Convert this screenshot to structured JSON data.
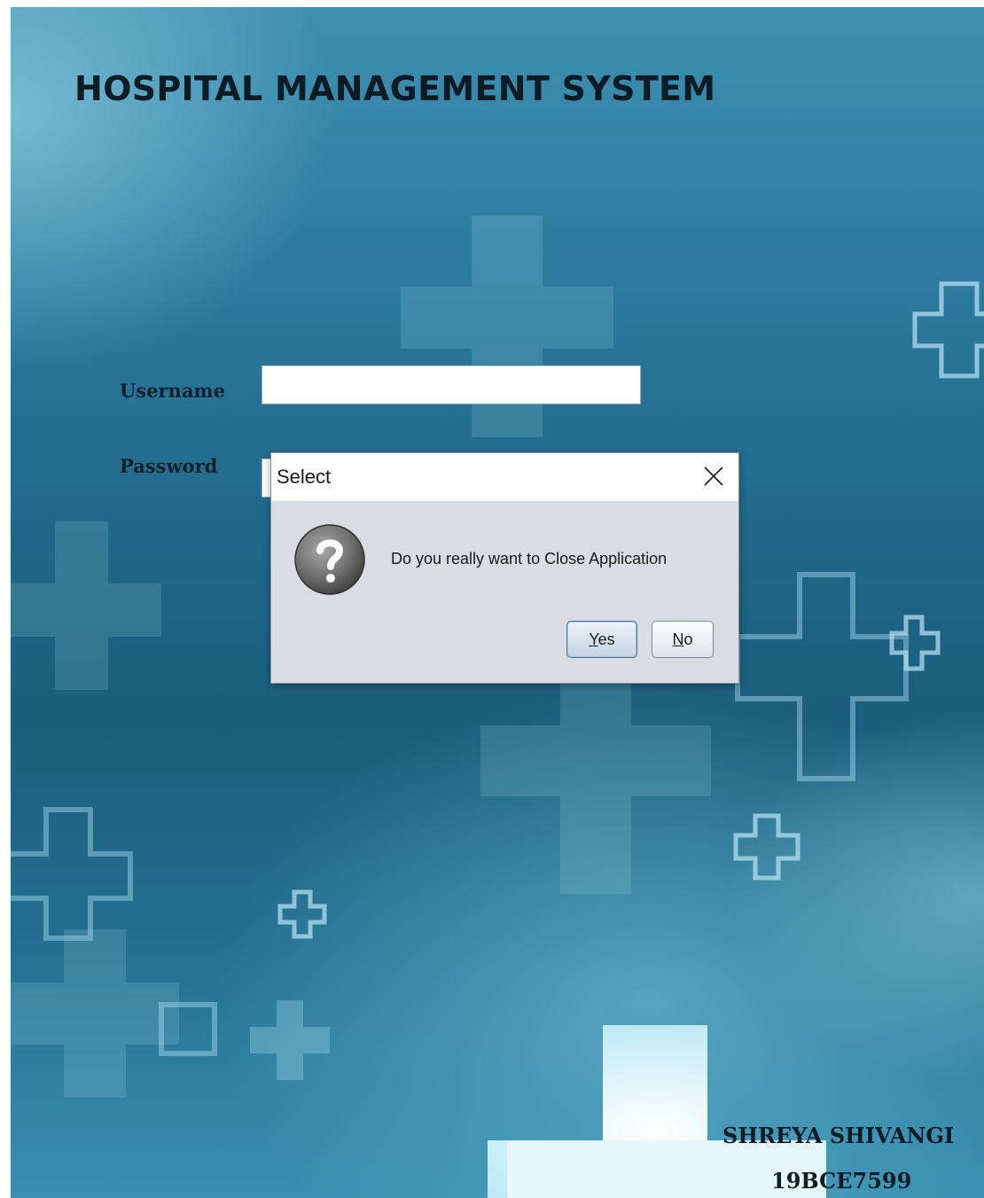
{
  "app": {
    "title": "HOSPITAL MANAGEMENT SYSTEM"
  },
  "login": {
    "username_label": "Username",
    "username_value": "",
    "password_label": "Password",
    "password_value": ""
  },
  "footer": {
    "name": "SHREYA SHIVANGI",
    "id": "19BCE7599"
  },
  "dialog": {
    "title": "Select",
    "message": "Do you really want to Close Application",
    "icon": "question-icon",
    "close_icon": "close-icon",
    "yes_mnemonic": "Y",
    "yes_rest": "es",
    "no_mnemonic": "N",
    "no_rest": "o"
  }
}
